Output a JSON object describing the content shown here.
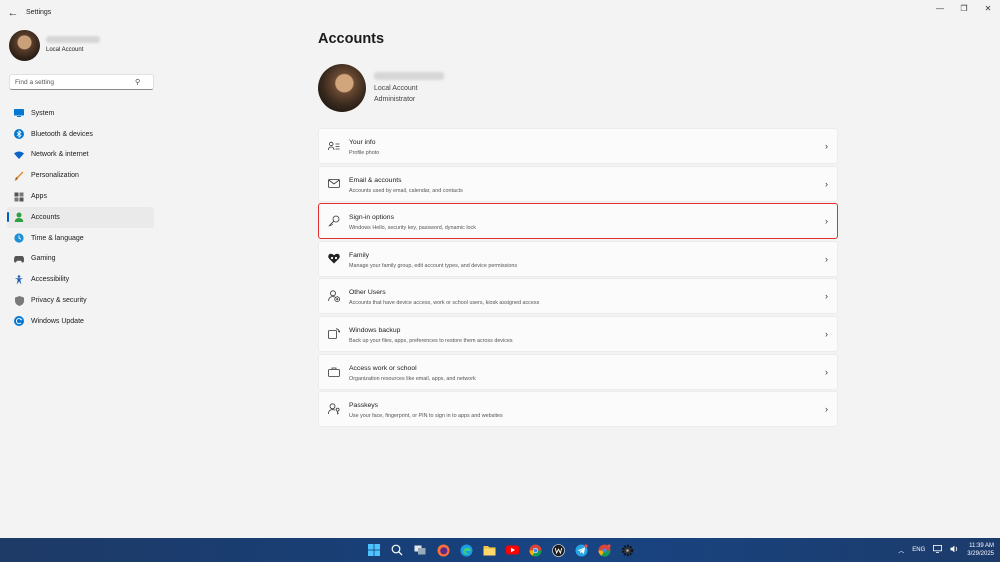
{
  "window": {
    "title": "Settings",
    "minimize": "—",
    "restore": "❐",
    "close": "✕"
  },
  "sidebar": {
    "account_type": "Local Account",
    "search_placeholder": "Find a setting",
    "items": [
      {
        "label": "System",
        "icon": "system-icon",
        "color": "#0078d4"
      },
      {
        "label": "Bluetooth & devices",
        "icon": "bluetooth-icon",
        "color": "#0078d4"
      },
      {
        "label": "Network & internet",
        "icon": "wifi-icon",
        "color": "#0a64c8"
      },
      {
        "label": "Personalization",
        "icon": "brush-icon",
        "color": "#e08a2c"
      },
      {
        "label": "Apps",
        "icon": "apps-icon",
        "color": "#555555"
      },
      {
        "label": "Accounts",
        "icon": "person-icon",
        "color": "#2ea043",
        "active": true
      },
      {
        "label": "Time & language",
        "icon": "globe-clock-icon",
        "color": "#1c8fd6"
      },
      {
        "label": "Gaming",
        "icon": "gamepad-icon",
        "color": "#555555"
      },
      {
        "label": "Accessibility",
        "icon": "accessibility-icon",
        "color": "#1a5fb4"
      },
      {
        "label": "Privacy & security",
        "icon": "shield-icon",
        "color": "#6b6b6b"
      },
      {
        "label": "Windows Update",
        "icon": "update-icon",
        "color": "#0078d4"
      }
    ]
  },
  "main": {
    "title": "Accounts",
    "account_type": "Local Account",
    "account_role": "Administrator",
    "cards": [
      {
        "title": "Your info",
        "subtitle": "Profile photo",
        "icon": "id-card-icon"
      },
      {
        "title": "Email & accounts",
        "subtitle": "Accounts used by email, calendar, and contacts",
        "icon": "mail-icon"
      },
      {
        "title": "Sign-in options",
        "subtitle": "Windows Hello, security key, password, dynamic lock",
        "icon": "key-icon",
        "highlighted": true
      },
      {
        "title": "Family",
        "subtitle": "Manage your family group, edit account types, and device permissions",
        "icon": "heart-icon"
      },
      {
        "title": "Other Users",
        "subtitle": "Accounts that have device access, work or school users, kiosk assigned access",
        "icon": "add-user-icon"
      },
      {
        "title": "Windows backup",
        "subtitle": "Back up your files, apps, preferences to restore them across devices",
        "icon": "backup-icon"
      },
      {
        "title": "Access work or school",
        "subtitle": "Organization resources like email, apps, and network",
        "icon": "briefcase-icon"
      },
      {
        "title": "Passkeys",
        "subtitle": "Use your face, fingerprint, or PIN to sign in to apps and websites",
        "icon": "passkey-icon"
      }
    ]
  },
  "taskbar": {
    "language": "ENG",
    "time": "11:39 AM",
    "date": "3/29/2025",
    "highlight_color": "#e0312f"
  }
}
